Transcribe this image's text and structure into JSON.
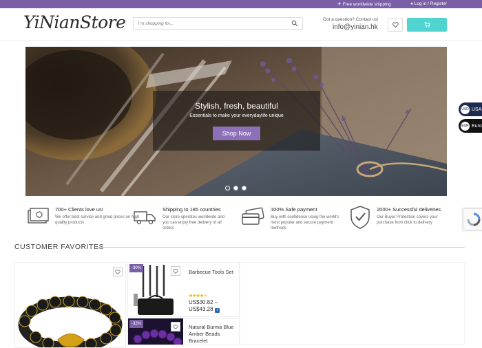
{
  "topbar": {
    "shipping": "Free worldwide shipping",
    "login": "Log in / Register",
    "bg_color": "#7b5fa6"
  },
  "header": {
    "logo": "YiNianStore",
    "search_placeholder": "I´m shopping for...",
    "contact_question": "Got a question? Contact us!",
    "contact_email": "info@yinian.hk",
    "cart_color": "#4fd4d0"
  },
  "hero": {
    "headline": "Stylish, fresh, beautiful",
    "subtitle": "Essentials to make your everydaylife unique",
    "cta": "Shop Now",
    "slides": 3,
    "active_slide": 1
  },
  "currency": [
    {
      "code": "USD",
      "label": "USA"
    },
    {
      "code": "EUR",
      "label": "Euro"
    }
  ],
  "features": [
    {
      "icon": "money-icon",
      "title": "700+ Clients love us!",
      "desc": "We offer best service and great prices on high quality products"
    },
    {
      "icon": "truck-icon",
      "title": "Shipping to 185 countries",
      "desc": "Our store operates worldwide and you can enjoy free delivery of all orders"
    },
    {
      "icon": "credit-card-icon",
      "title": "100% Safe payment",
      "desc": "Buy with confidence using the world's most popular and secure payment methods"
    },
    {
      "icon": "shield-check-icon",
      "title": "2000+ Successful deliveries",
      "desc": "Our Buyer Protection covers your purchase from click to delivery"
    }
  ],
  "favorites": {
    "title": "CUSTOMER FAVORITES",
    "products": [
      {
        "name": "Barbecue Tools Set",
        "discount": "-30%",
        "rating": 4.5,
        "price_current": "US$30.82",
        "price_dash": "–",
        "price_max": "US$43.28"
      },
      {
        "name": "Natural Burma Blue Amber Beads Bracelet",
        "discount": "-32%"
      }
    ]
  }
}
